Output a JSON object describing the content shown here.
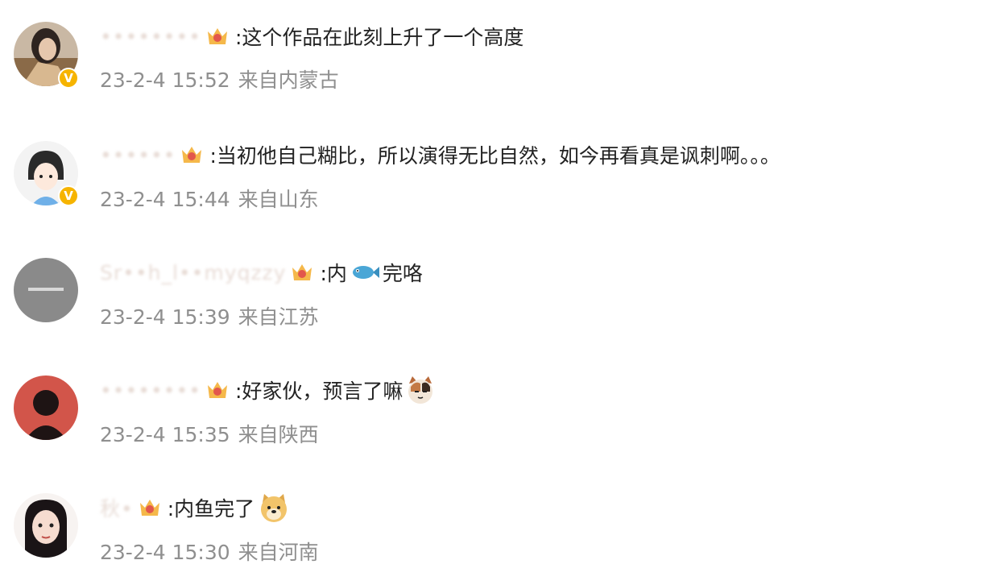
{
  "comments": [
    {
      "username": "••••••••",
      "text": ":这个作品在此刻上升了一个高度",
      "time": "23-2-4 15:52",
      "location": "来自内蒙古",
      "verified": true
    },
    {
      "username": "••••••",
      "text": ":当初他自己糊比，所以演得无比自然，如今再看真是讽刺啊。。。",
      "time": "23-2-4 15:44",
      "location": "来自山东",
      "verified": true
    },
    {
      "username": "Sr••h_l••myqzzy",
      "text_a": ":内",
      "text_b": "完咯",
      "time": "23-2-4 15:39",
      "location": "来自江苏",
      "verified": false
    },
    {
      "username": "••••••••",
      "text": ":好家伙，预言了嘛",
      "time": "23-2-4 15:35",
      "location": "来自陕西",
      "verified": false
    },
    {
      "username": "秋•",
      "text": ":内鱼完了",
      "time": "23-2-4 15:30",
      "location": "来自河南",
      "verified": false
    }
  ],
  "icons": {
    "verified": "verified-v-badge",
    "level": "crown-level-badge",
    "fish": "fish-emoji",
    "cat": "cat-emoji",
    "doge": "doge-emoji"
  },
  "colors": {
    "meta": "#8f8f8f",
    "verified": "#f6b400",
    "text": "#222222"
  }
}
